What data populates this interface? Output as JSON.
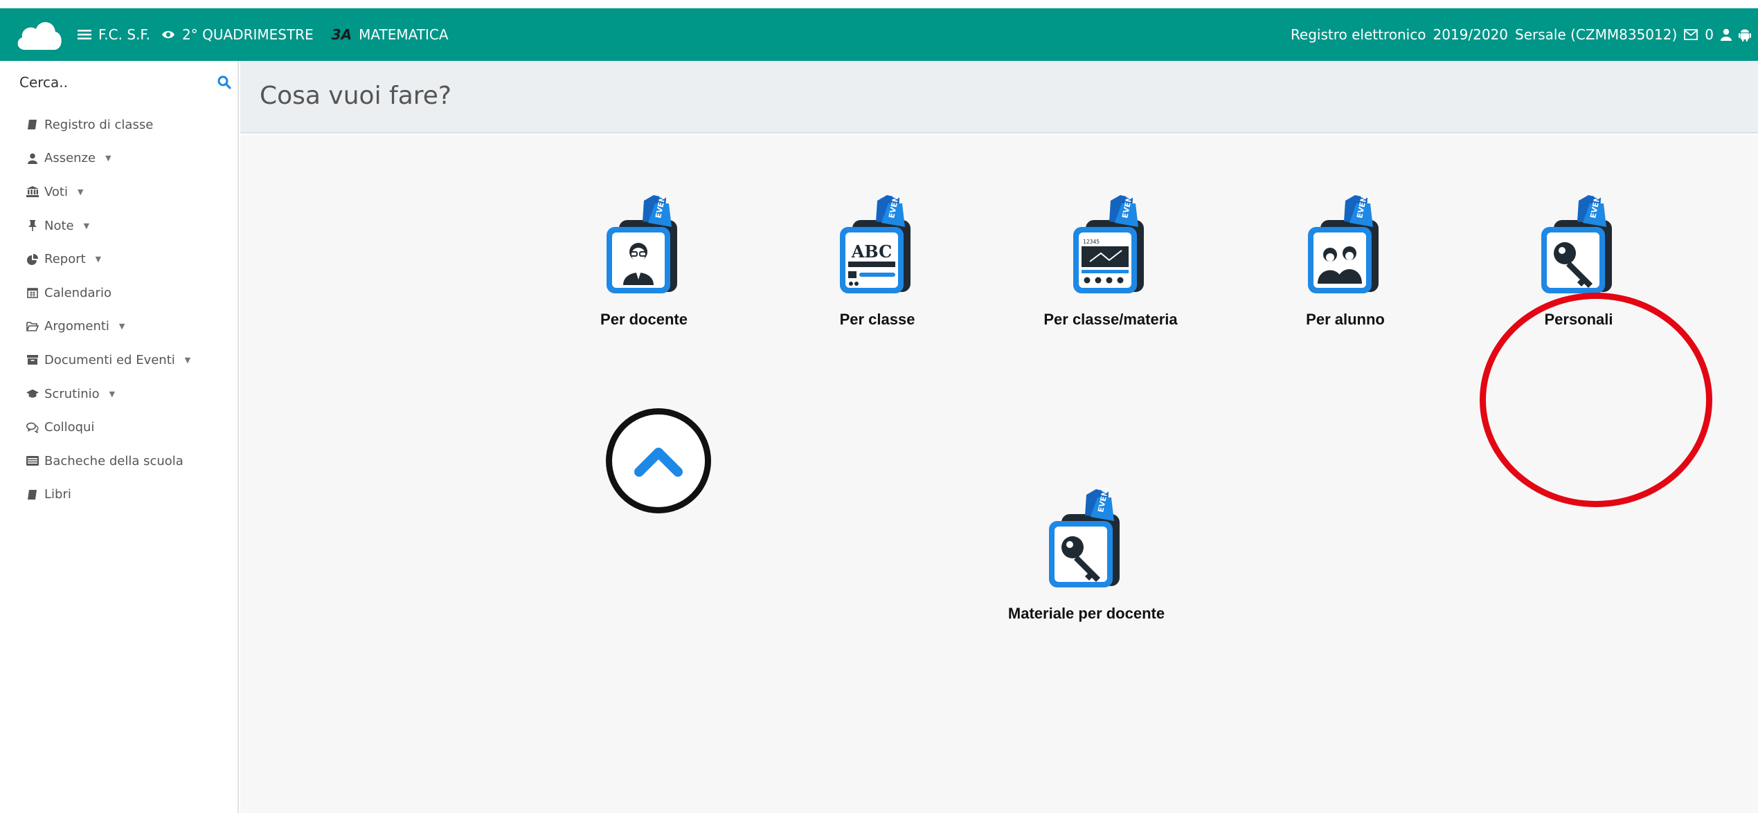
{
  "header": {
    "user_initials": "F.C. S.F.",
    "period": "2° QUADRIMESTRE",
    "class_code": "3A",
    "subject": "MATEMATICA",
    "app_name": "Registro elettronico",
    "school_year": "2019/2020",
    "school": "Sersale (CZMM835012)",
    "message_count": "0"
  },
  "sidebar": {
    "search_placeholder": "Cerca..",
    "items": [
      {
        "label": "Registro di classe",
        "icon": "book-icon",
        "has_caret": false
      },
      {
        "label": "Assenze",
        "icon": "user-icon",
        "has_caret": true
      },
      {
        "label": "Voti",
        "icon": "bank-icon",
        "has_caret": true
      },
      {
        "label": "Note",
        "icon": "pin-icon",
        "has_caret": true
      },
      {
        "label": "Report",
        "icon": "pie-chart-icon",
        "has_caret": true
      },
      {
        "label": "Calendario",
        "icon": "calendar-icon",
        "has_caret": false
      },
      {
        "label": "Argomenti",
        "icon": "folder-open-icon",
        "has_caret": true
      },
      {
        "label": "Documenti ed Eventi",
        "icon": "archive-icon",
        "has_caret": true
      },
      {
        "label": "Scrutinio",
        "icon": "graduation-cap-icon",
        "has_caret": true
      },
      {
        "label": "Colloqui",
        "icon": "comments-icon",
        "has_caret": false
      },
      {
        "label": "Bacheche della scuola",
        "icon": "board-icon",
        "has_caret": false
      },
      {
        "label": "Libri",
        "icon": "book-icon",
        "has_caret": false
      }
    ]
  },
  "page": {
    "title": "Cosa vuoi fare?"
  },
  "tiles": [
    {
      "label": "Per docente",
      "icon": "teacher-icon"
    },
    {
      "label": "Per classe",
      "icon": "abc-class-icon"
    },
    {
      "label": "Per classe/materia",
      "icon": "class-subject-icon"
    },
    {
      "label": "Per alunno",
      "icon": "students-icon"
    },
    {
      "label": "Personali",
      "icon": "key-icon"
    },
    {
      "label": "Materiale per docente",
      "icon": "key-icon"
    }
  ],
  "colors": {
    "topbar": "#009688",
    "accent": "#1e88e5",
    "highlight": "#e30613"
  }
}
